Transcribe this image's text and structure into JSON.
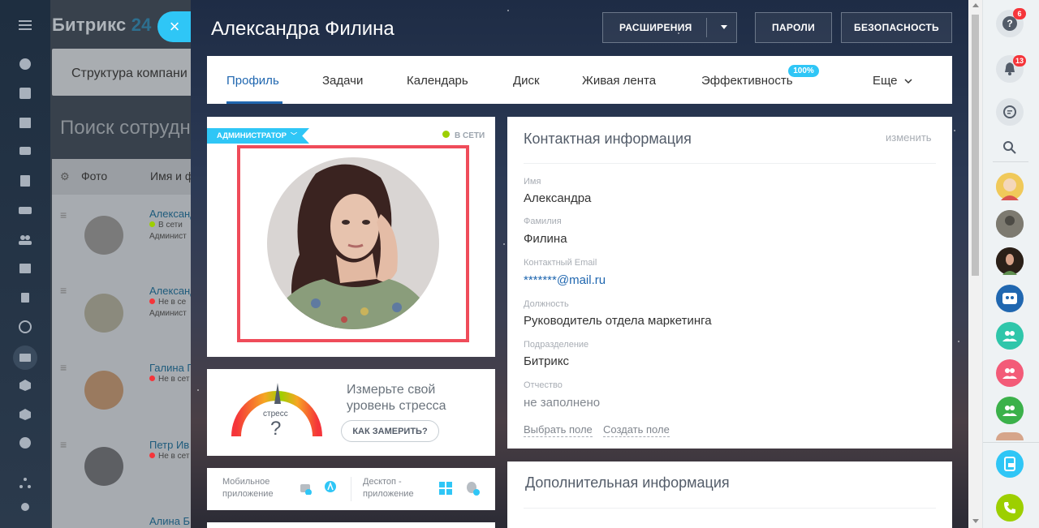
{
  "background_page": {
    "logo_text": "Битрикс",
    "logo_num": "24",
    "structure_label": "Структура компани",
    "search_title": "Поиск сотрудн",
    "col_photo": "Фото",
    "col_name": "Имя и ф",
    "rows": [
      {
        "name": "Александ",
        "status": "В сети",
        "role": "Админист",
        "status_color": "#9dcf00"
      },
      {
        "name": "Александ",
        "status": "Не в се",
        "role": "Админист",
        "status_color": "#f5353a"
      },
      {
        "name": "Галина Г",
        "status": "Не в сет",
        "role": "",
        "status_color": "#f5353a"
      },
      {
        "name": "Петр Ив",
        "status": "Не в сет",
        "role": "",
        "status_color": "#f5353a"
      },
      {
        "name": "Алина Б",
        "status": "",
        "role": "",
        "status_color": "#f5353a"
      }
    ]
  },
  "slider": {
    "close_icon": "×",
    "title": "Александра Филина",
    "buttons": {
      "extensions": "РАСШИРЕНИЯ",
      "passwords": "ПАРОЛИ",
      "security": "БЕЗОПАСНОСТЬ"
    },
    "tabs": [
      {
        "label": "Профиль"
      },
      {
        "label": "Задачи"
      },
      {
        "label": "Календарь"
      },
      {
        "label": "Диск"
      },
      {
        "label": "Живая лента"
      },
      {
        "label": "Эффективность"
      },
      {
        "label": "Еще"
      }
    ],
    "efficiency_badge": "100%",
    "profile": {
      "role_badge": "АДМИНИСТРАТОР",
      "online_status": "В СЕТИ"
    },
    "stress": {
      "gauge_label": "стресс",
      "gauge_value": "?",
      "text": "Измерьте свой уровень стресса",
      "button": "КАК ЗАМЕРИТЬ?"
    },
    "apps": {
      "mobile": "Мобильное приложение",
      "desktop": "Десктоп - приложение"
    },
    "contact": {
      "title": "Контактная информация",
      "edit": "изменить",
      "fields": [
        {
          "label": "Имя",
          "value": "Александра"
        },
        {
          "label": "Фамилия",
          "value": "Филина"
        },
        {
          "label": "Контактный Email",
          "value": "*******@mail.ru"
        },
        {
          "label": "Должность",
          "value": "Руководитель отдела маркетинга"
        },
        {
          "label": "Подразделение",
          "value": "Битрикс"
        },
        {
          "label": "Отчество",
          "value": "не заполнено"
        }
      ],
      "choose_field": "Выбрать поле",
      "create_field": "Создать поле"
    },
    "additional": {
      "title": "Дополнительная информация"
    }
  },
  "right_panel": {
    "help_badge": "6",
    "notif_badge": "13"
  }
}
